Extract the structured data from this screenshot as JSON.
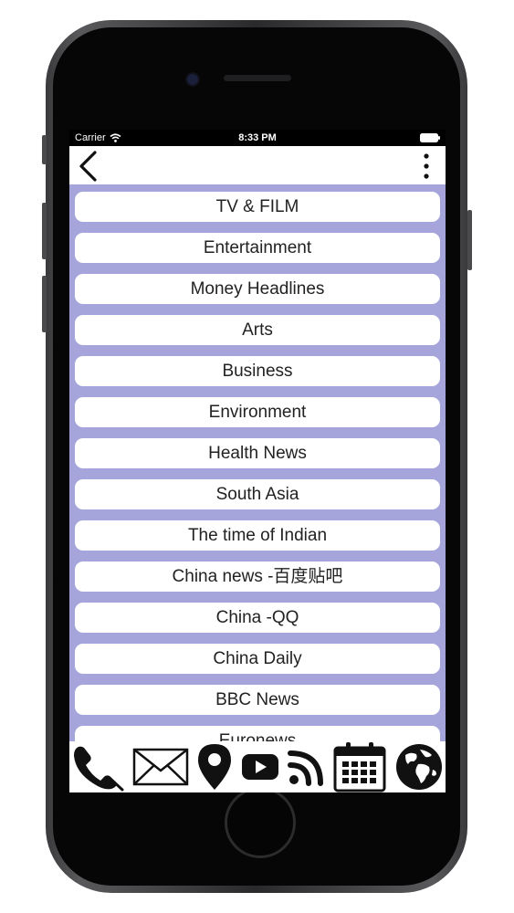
{
  "status_bar": {
    "carrier": "Carrier",
    "time": "8:33 PM"
  },
  "nav": {
    "back_icon": "chevron-left-icon",
    "menu_icon": "more-vertical-icon"
  },
  "categories": [
    "TV & FILM",
    "Entertainment",
    "Money Headlines",
    "Arts",
    "Business",
    "Environment",
    "Health News",
    "South Asia",
    "The time of Indian",
    "China news -百度贴吧",
    "China -QQ",
    "China Daily",
    "BBC News",
    "Euronews"
  ],
  "tab_bar": {
    "icons": [
      "phone-icon",
      "mail-icon",
      "location-pin-icon",
      "youtube-icon",
      "rss-icon",
      "calendar-icon",
      "globe-icon"
    ]
  },
  "colors": {
    "list_background": "#a5a5dc",
    "item_background": "#ffffff",
    "screen_background": "#000000"
  }
}
